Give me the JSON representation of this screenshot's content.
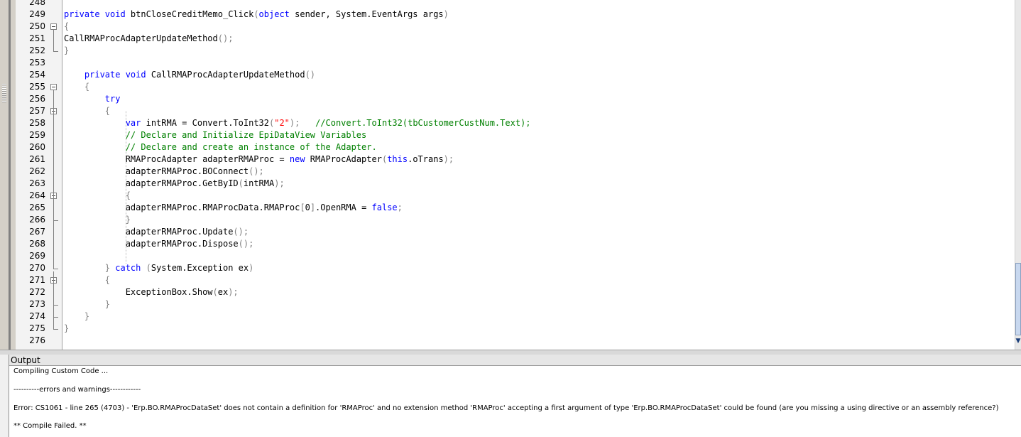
{
  "editor": {
    "lines": [
      {
        "num": "248",
        "tokens": []
      },
      {
        "num": "249",
        "tokens": [
          [
            "kw",
            "private void "
          ],
          [
            "",
            "btnCloseCreditMemo_Click"
          ],
          [
            "pn",
            "("
          ],
          [
            "kw",
            "object "
          ],
          [
            "",
            "sender, System.EventArgs args"
          ],
          [
            "pn",
            ")"
          ]
        ]
      },
      {
        "num": "250",
        "tokens": [
          [
            "pn",
            "{"
          ]
        ]
      },
      {
        "num": "251",
        "tokens": [
          [
            "",
            "CallRMAProcAdapterUpdateMethod"
          ],
          [
            "pn",
            "();"
          ]
        ]
      },
      {
        "num": "252",
        "tokens": [
          [
            "pn",
            "}"
          ]
        ]
      },
      {
        "num": "253",
        "tokens": []
      },
      {
        "num": "254",
        "tokens": [
          [
            "",
            "    "
          ],
          [
            "kw",
            "private void "
          ],
          [
            "",
            "CallRMAProcAdapterUpdateMethod"
          ],
          [
            "pn",
            "()"
          ]
        ]
      },
      {
        "num": "255",
        "tokens": [
          [
            "",
            "    "
          ],
          [
            "pn",
            "{"
          ]
        ]
      },
      {
        "num": "256",
        "tokens": [
          [
            "",
            "        "
          ],
          [
            "kw",
            "try"
          ]
        ]
      },
      {
        "num": "257",
        "tokens": [
          [
            "",
            "        "
          ],
          [
            "pn",
            "{"
          ]
        ]
      },
      {
        "num": "258",
        "tokens": [
          [
            "",
            "            "
          ],
          [
            "kw",
            "var "
          ],
          [
            "",
            "intRMA = Convert.ToInt32"
          ],
          [
            "pn",
            "("
          ],
          [
            "str",
            "\"2\""
          ],
          [
            "pn",
            ");"
          ],
          [
            "",
            "   "
          ],
          [
            "cm",
            "//Convert.ToInt32(tbCustomerCustNum.Text);"
          ]
        ]
      },
      {
        "num": "259",
        "tokens": [
          [
            "",
            "            "
          ],
          [
            "cm",
            "// Declare and Initialize EpiDataView Variables"
          ]
        ]
      },
      {
        "num": "260",
        "tokens": [
          [
            "",
            "            "
          ],
          [
            "cm",
            "// Declare and create an instance of the Adapter."
          ]
        ]
      },
      {
        "num": "261",
        "tokens": [
          [
            "",
            "            RMAProcAdapter adapterRMAProc = "
          ],
          [
            "kw",
            "new "
          ],
          [
            "",
            "RMAProcAdapter"
          ],
          [
            "pn",
            "("
          ],
          [
            "kw",
            "this"
          ],
          [
            "",
            ".oTrans"
          ],
          [
            "pn",
            ");"
          ]
        ]
      },
      {
        "num": "262",
        "tokens": [
          [
            "",
            "            adapterRMAProc.BOConnect"
          ],
          [
            "pn",
            "();"
          ]
        ]
      },
      {
        "num": "263",
        "tokens": [
          [
            "",
            "            adapterRMAProc.GetByID"
          ],
          [
            "pn",
            "("
          ],
          [
            "",
            "intRMA"
          ],
          [
            "pn",
            ");"
          ]
        ]
      },
      {
        "num": "264",
        "tokens": [
          [
            "",
            "            "
          ],
          [
            "pn",
            "{"
          ]
        ]
      },
      {
        "num": "265",
        "tokens": [
          [
            "",
            "            adapterRMAProc.RMAProcData.RMAProc"
          ],
          [
            "pn",
            "["
          ],
          [
            "",
            "0"
          ],
          [
            "pn",
            "]"
          ],
          [
            "",
            ".OpenRMA = "
          ],
          [
            "kw",
            "false"
          ],
          [
            "pn",
            ";"
          ]
        ]
      },
      {
        "num": "266",
        "tokens": [
          [
            "",
            "            "
          ],
          [
            "pn",
            "}"
          ]
        ]
      },
      {
        "num": "267",
        "tokens": [
          [
            "",
            "            adapterRMAProc.Update"
          ],
          [
            "pn",
            "();"
          ]
        ]
      },
      {
        "num": "268",
        "tokens": [
          [
            "",
            "            adapterRMAProc.Dispose"
          ],
          [
            "pn",
            "();"
          ]
        ]
      },
      {
        "num": "269",
        "tokens": []
      },
      {
        "num": "270",
        "tokens": [
          [
            "",
            "        "
          ],
          [
            "pn",
            "} "
          ],
          [
            "kw",
            "catch "
          ],
          [
            "pn",
            "("
          ],
          [
            "",
            "System.Exception ex"
          ],
          [
            "pn",
            ")"
          ]
        ]
      },
      {
        "num": "271",
        "tokens": [
          [
            "",
            "        "
          ],
          [
            "pn",
            "{"
          ]
        ]
      },
      {
        "num": "272",
        "tokens": [
          [
            "",
            "            ExceptionBox.Show"
          ],
          [
            "pn",
            "("
          ],
          [
            "",
            "ex"
          ],
          [
            "pn",
            ");"
          ]
        ]
      },
      {
        "num": "273",
        "tokens": [
          [
            "",
            "        "
          ],
          [
            "pn",
            "}"
          ]
        ]
      },
      {
        "num": "274",
        "tokens": [
          [
            "",
            "    "
          ],
          [
            "pn",
            "}"
          ]
        ]
      },
      {
        "num": "275",
        "tokens": [
          [
            "pn",
            "}"
          ]
        ]
      },
      {
        "num": "276",
        "tokens": []
      }
    ]
  },
  "output": {
    "title": "Output",
    "lines": [
      "Compiling Custom Code ...",
      "----------errors and warnings------------",
      " Error: CS1061 - line 265 (4703) - 'Erp.BO.RMAProcDataSet' does not contain a definition for 'RMAProc' and no extension method 'RMAProc' accepting a first argument of type 'Erp.BO.RMAProcDataSet' could be found (are you missing a using directive or an assembly reference?)",
      " ** Compile Failed. **"
    ]
  },
  "colors": {
    "keyword": "#0000ff",
    "string": "#ff0000",
    "comment": "#008000",
    "punctuation": "#808080"
  },
  "icons": [
    "collapse-icon",
    "scroll-down-icon"
  ]
}
